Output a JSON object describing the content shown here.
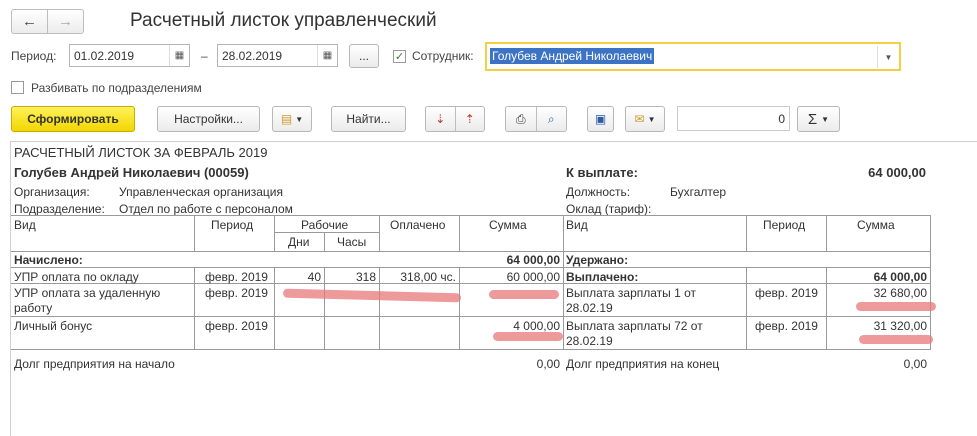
{
  "window": {
    "title": "Расчетный листок управленческий"
  },
  "nav": {
    "back": "←",
    "forward": "→"
  },
  "filters": {
    "period_label": "Период:",
    "date_from": "01.02.2019",
    "dash": "–",
    "date_to": "28.02.2019",
    "more_btn": "...",
    "employee_label": "Сотрудник:",
    "employee_checked": "✓",
    "employee_value": "Голубев Андрей Николаевич",
    "split_label": "Разбивать по подразделениям"
  },
  "toolbar": {
    "generate": "Сформировать",
    "settings": "Настройки...",
    "find": "Найти...",
    "number_value": "0",
    "sigma": "Σ"
  },
  "report": {
    "header": "РАСЧЕТНЫЙ ЛИСТОК ЗА ФЕВРАЛЬ 2019",
    "employee": "Голубев Андрей Николаевич (00059)",
    "to_pay_label": "К выплате:",
    "to_pay_value": "64 000,00",
    "org_label": "Организация:",
    "org_value": "Управленческая организация",
    "position_label": "Должность:",
    "position_value": "Бухгалтер",
    "dept_label": "Подразделение:",
    "dept_value": "Отдел по работе с персоналом",
    "salary_label": "Оклад (тариф):",
    "cols": {
      "kind": "Вид",
      "period": "Период",
      "working": "Рабочие",
      "days": "Дни",
      "hours": "Часы",
      "paid": "Оплачено",
      "sum": "Сумма",
      "kind2": "Вид",
      "period2": "Период",
      "sum2": "Сумма"
    },
    "accrued_label": "Начислено:",
    "accrued_total": "64 000,00",
    "withheld_label": "Удержано:",
    "paid_out_label": "Выплачено:",
    "paid_out_total": "64 000,00",
    "left_rows": [
      {
        "kind": "УПР оплата по окладу",
        "period": "февр. 2019",
        "days": "40",
        "hours": "318",
        "paid": "318,00 чс.",
        "sum": "60 000,00"
      },
      {
        "kind": "УПР оплата за удаленную работу",
        "period": "февр. 2019",
        "days": "",
        "hours": "",
        "paid": "",
        "sum": ""
      },
      {
        "kind": "Личный бонус",
        "period": "февр. 2019",
        "days": "",
        "hours": "",
        "paid": "",
        "sum": "4 000,00"
      }
    ],
    "right_rows": [
      {
        "kind": "Выплата зарплаты 1 от 28.02.19",
        "period": "февр. 2019",
        "sum": "32 680,00"
      },
      {
        "kind": "Выплата зарплаты 72 от 28.02.19",
        "period": "февр. 2019",
        "sum": "31 320,00"
      }
    ],
    "debt_start_label": "Долг предприятия на начало",
    "debt_start_value": "0,00",
    "debt_end_label": "Долг предприятия на конец",
    "debt_end_value": "0,00"
  },
  "colors": {
    "primary_button": "#f2d600",
    "selection": "#3d73c4",
    "redaction": "#e87878",
    "focus_border": "#f2cf45"
  }
}
